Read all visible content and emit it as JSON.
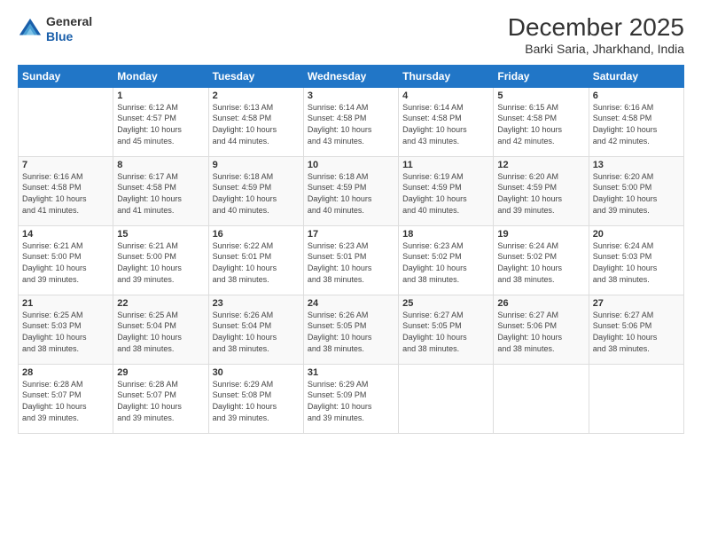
{
  "logo": {
    "general": "General",
    "blue": "Blue"
  },
  "title": "December 2025",
  "subtitle": "Barki Saria, Jharkhand, India",
  "header_days": [
    "Sunday",
    "Monday",
    "Tuesday",
    "Wednesday",
    "Thursday",
    "Friday",
    "Saturday"
  ],
  "weeks": [
    [
      {
        "day": "",
        "info": ""
      },
      {
        "day": "1",
        "info": "Sunrise: 6:12 AM\nSunset: 4:57 PM\nDaylight: 10 hours\nand 45 minutes."
      },
      {
        "day": "2",
        "info": "Sunrise: 6:13 AM\nSunset: 4:58 PM\nDaylight: 10 hours\nand 44 minutes."
      },
      {
        "day": "3",
        "info": "Sunrise: 6:14 AM\nSunset: 4:58 PM\nDaylight: 10 hours\nand 43 minutes."
      },
      {
        "day": "4",
        "info": "Sunrise: 6:14 AM\nSunset: 4:58 PM\nDaylight: 10 hours\nand 43 minutes."
      },
      {
        "day": "5",
        "info": "Sunrise: 6:15 AM\nSunset: 4:58 PM\nDaylight: 10 hours\nand 42 minutes."
      },
      {
        "day": "6",
        "info": "Sunrise: 6:16 AM\nSunset: 4:58 PM\nDaylight: 10 hours\nand 42 minutes."
      }
    ],
    [
      {
        "day": "7",
        "info": "Sunrise: 6:16 AM\nSunset: 4:58 PM\nDaylight: 10 hours\nand 41 minutes."
      },
      {
        "day": "8",
        "info": "Sunrise: 6:17 AM\nSunset: 4:58 PM\nDaylight: 10 hours\nand 41 minutes."
      },
      {
        "day": "9",
        "info": "Sunrise: 6:18 AM\nSunset: 4:59 PM\nDaylight: 10 hours\nand 40 minutes."
      },
      {
        "day": "10",
        "info": "Sunrise: 6:18 AM\nSunset: 4:59 PM\nDaylight: 10 hours\nand 40 minutes."
      },
      {
        "day": "11",
        "info": "Sunrise: 6:19 AM\nSunset: 4:59 PM\nDaylight: 10 hours\nand 40 minutes."
      },
      {
        "day": "12",
        "info": "Sunrise: 6:20 AM\nSunset: 4:59 PM\nDaylight: 10 hours\nand 39 minutes."
      },
      {
        "day": "13",
        "info": "Sunrise: 6:20 AM\nSunset: 5:00 PM\nDaylight: 10 hours\nand 39 minutes."
      }
    ],
    [
      {
        "day": "14",
        "info": "Sunrise: 6:21 AM\nSunset: 5:00 PM\nDaylight: 10 hours\nand 39 minutes."
      },
      {
        "day": "15",
        "info": "Sunrise: 6:21 AM\nSunset: 5:00 PM\nDaylight: 10 hours\nand 39 minutes."
      },
      {
        "day": "16",
        "info": "Sunrise: 6:22 AM\nSunset: 5:01 PM\nDaylight: 10 hours\nand 38 minutes."
      },
      {
        "day": "17",
        "info": "Sunrise: 6:23 AM\nSunset: 5:01 PM\nDaylight: 10 hours\nand 38 minutes."
      },
      {
        "day": "18",
        "info": "Sunrise: 6:23 AM\nSunset: 5:02 PM\nDaylight: 10 hours\nand 38 minutes."
      },
      {
        "day": "19",
        "info": "Sunrise: 6:24 AM\nSunset: 5:02 PM\nDaylight: 10 hours\nand 38 minutes."
      },
      {
        "day": "20",
        "info": "Sunrise: 6:24 AM\nSunset: 5:03 PM\nDaylight: 10 hours\nand 38 minutes."
      }
    ],
    [
      {
        "day": "21",
        "info": "Sunrise: 6:25 AM\nSunset: 5:03 PM\nDaylight: 10 hours\nand 38 minutes."
      },
      {
        "day": "22",
        "info": "Sunrise: 6:25 AM\nSunset: 5:04 PM\nDaylight: 10 hours\nand 38 minutes."
      },
      {
        "day": "23",
        "info": "Sunrise: 6:26 AM\nSunset: 5:04 PM\nDaylight: 10 hours\nand 38 minutes."
      },
      {
        "day": "24",
        "info": "Sunrise: 6:26 AM\nSunset: 5:05 PM\nDaylight: 10 hours\nand 38 minutes."
      },
      {
        "day": "25",
        "info": "Sunrise: 6:27 AM\nSunset: 5:05 PM\nDaylight: 10 hours\nand 38 minutes."
      },
      {
        "day": "26",
        "info": "Sunrise: 6:27 AM\nSunset: 5:06 PM\nDaylight: 10 hours\nand 38 minutes."
      },
      {
        "day": "27",
        "info": "Sunrise: 6:27 AM\nSunset: 5:06 PM\nDaylight: 10 hours\nand 38 minutes."
      }
    ],
    [
      {
        "day": "28",
        "info": "Sunrise: 6:28 AM\nSunset: 5:07 PM\nDaylight: 10 hours\nand 39 minutes."
      },
      {
        "day": "29",
        "info": "Sunrise: 6:28 AM\nSunset: 5:07 PM\nDaylight: 10 hours\nand 39 minutes."
      },
      {
        "day": "30",
        "info": "Sunrise: 6:29 AM\nSunset: 5:08 PM\nDaylight: 10 hours\nand 39 minutes."
      },
      {
        "day": "31",
        "info": "Sunrise: 6:29 AM\nSunset: 5:09 PM\nDaylight: 10 hours\nand 39 minutes."
      },
      {
        "day": "",
        "info": ""
      },
      {
        "day": "",
        "info": ""
      },
      {
        "day": "",
        "info": ""
      }
    ]
  ]
}
